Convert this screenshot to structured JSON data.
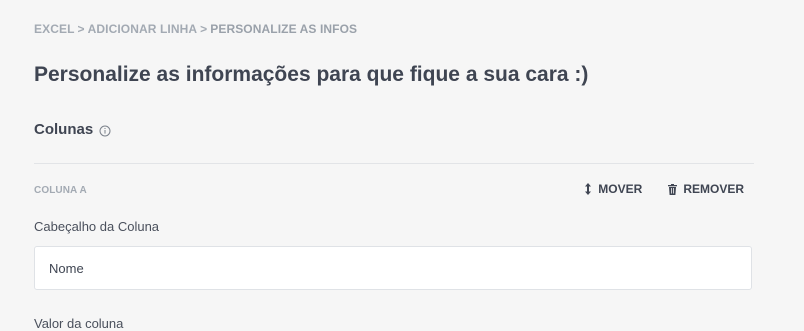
{
  "breadcrumb": {
    "items": [
      "EXCEL",
      "ADICIONAR LINHA",
      "PERSONALIZE AS INFOS"
    ],
    "separator": ">"
  },
  "page": {
    "title": "Personalize as informações para que fique a sua cara :)"
  },
  "columns_section": {
    "title": "Colunas",
    "info_icon": "info-icon"
  },
  "column": {
    "label": "COLUNA A",
    "move_label": "MOVER",
    "remove_label": "REMOVER",
    "header_field_label": "Cabeçalho da Coluna",
    "header_value": "Nome",
    "value_field_label": "Valor da coluna"
  },
  "colors": {
    "background": "#f6f6f6",
    "text": "#3f4552",
    "muted": "#a3aab3",
    "border": "#dfe2e6"
  }
}
